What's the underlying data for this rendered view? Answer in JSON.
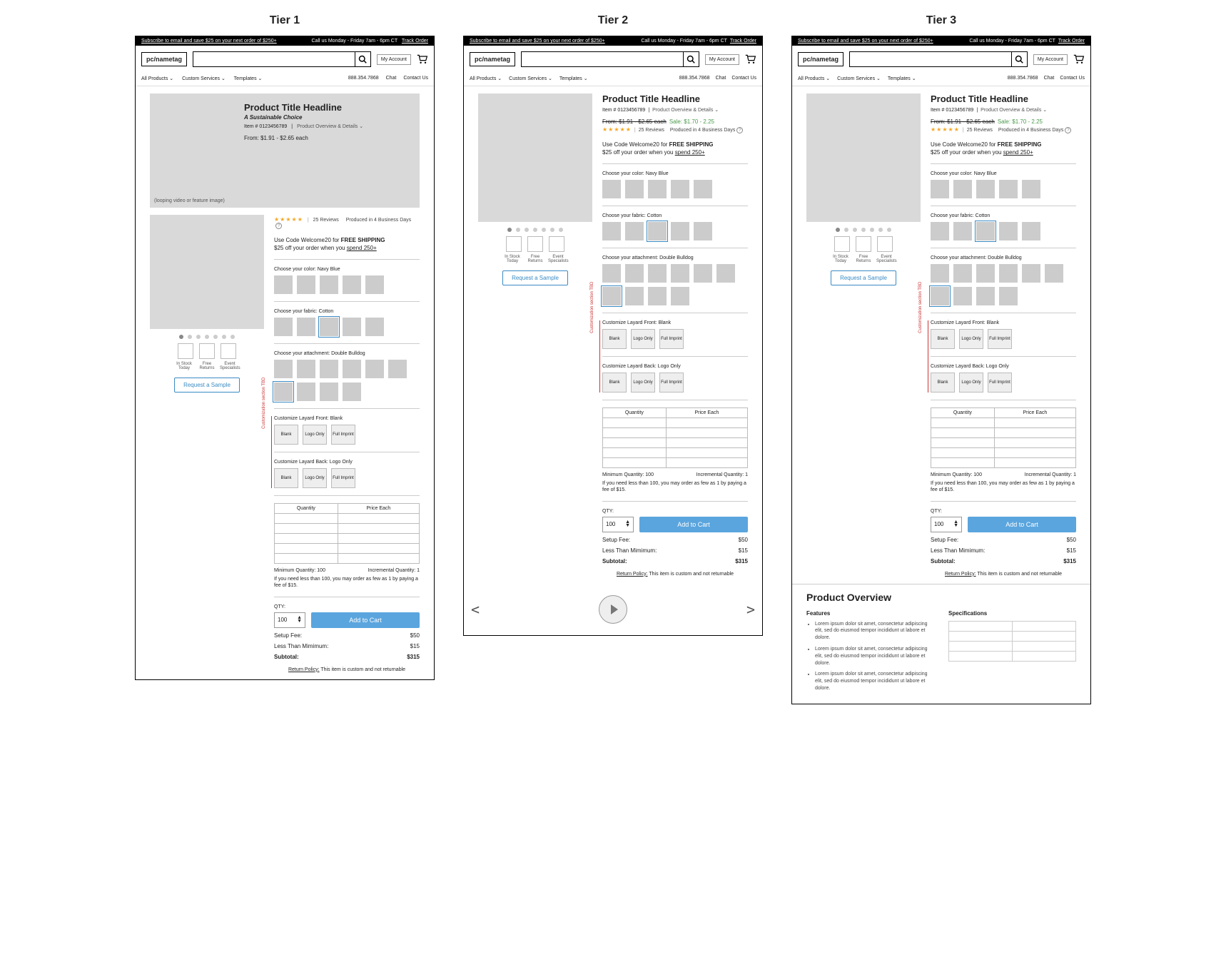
{
  "tier_labels": [
    "Tier 1",
    "Tier 2",
    "Tier 3"
  ],
  "blackbar": {
    "subscribe": "Subscribe to email and save $25 on your next order of $250+",
    "hours": "Call us Monday - Friday 7am - 6pm CT",
    "track": "Track Order"
  },
  "header": {
    "logo": "pc/nametag",
    "account": "My Account"
  },
  "nav": {
    "left": [
      "All Products ⌄",
      "Custom Services ⌄",
      "Templates ⌄"
    ],
    "right": [
      "888.354.7868",
      "Chat",
      "Contact Us"
    ]
  },
  "product": {
    "title": "Product Title Headline",
    "subtitle": "A Sustainable Choice",
    "item_no": "Item # 0123456789",
    "detail_dropdown": "Product Overview & Details  ⌄",
    "price_from": "From: $1.91 - $2.65 each",
    "sale_label": "Sale: $1.70 - 2.25",
    "reviews": "25 Reviews",
    "produced": "Produced in 4 Business Days",
    "promo_line1_a": "Use Code Welcome20 for ",
    "promo_line1_b": "FREE SHIPPING",
    "promo_line2_a": "$25 off your order when you ",
    "promo_line2_b": "spend 250+"
  },
  "hero_caption": "(looping video or feature image)",
  "gallery_labels": [
    "In Stock Today",
    "Free Returns",
    "Event Specialists"
  ],
  "sample_btn": "Request a Sample",
  "options": {
    "color": "Choose your color: Navy Blue",
    "fabric": "Choose your fabric: Cotton",
    "attachment": "Choose your attachment: Double Bulldog",
    "front": "Customize Layard Front: Blank",
    "back": "Customize Layard Back: Logo Only",
    "custom_note": "Customization section TBD",
    "custom_buttons": [
      "Blank",
      "Logo Only",
      "Full Imprint"
    ]
  },
  "pricing": {
    "headers": [
      "Quantity",
      "Price Each"
    ],
    "min_qty": "Minimum Quantity: 100",
    "inc_qty": "Incremental Quantity: 1",
    "less_note": "If you need less than 100, you may order as few as 1 by paying a fee of $15.",
    "qty_label": "QTY:",
    "qty_value": "100",
    "add_cart": "Add to Cart",
    "setup_lbl": "Setup Fee:",
    "setup_val": "$50",
    "less_lbl": "Less Than Mimimum:",
    "less_val": "$15",
    "sub_lbl": "Subtotal:",
    "sub_val": "$315",
    "return_u": "Return Policy:",
    "return_txt": " This item is custom and not returnable"
  },
  "overview": {
    "title": "Product Overview",
    "features_h": "Features",
    "specs_h": "Specifications",
    "bullets": [
      "Lorem ipsum dolor sit amet, consectetur adipiscing elit, sed do eiusmod tempor incididunt ut labore et dolore.",
      "Lorem ipsum dolor sit amet, consectetur adipiscing elit, sed do eiusmod tempor incididunt ut labore et dolore.",
      "Lorem ipsum dolor sit amet, consectetur adipiscing elit, sed do eiusmod tempor incididunt ut labore et dolore."
    ]
  }
}
